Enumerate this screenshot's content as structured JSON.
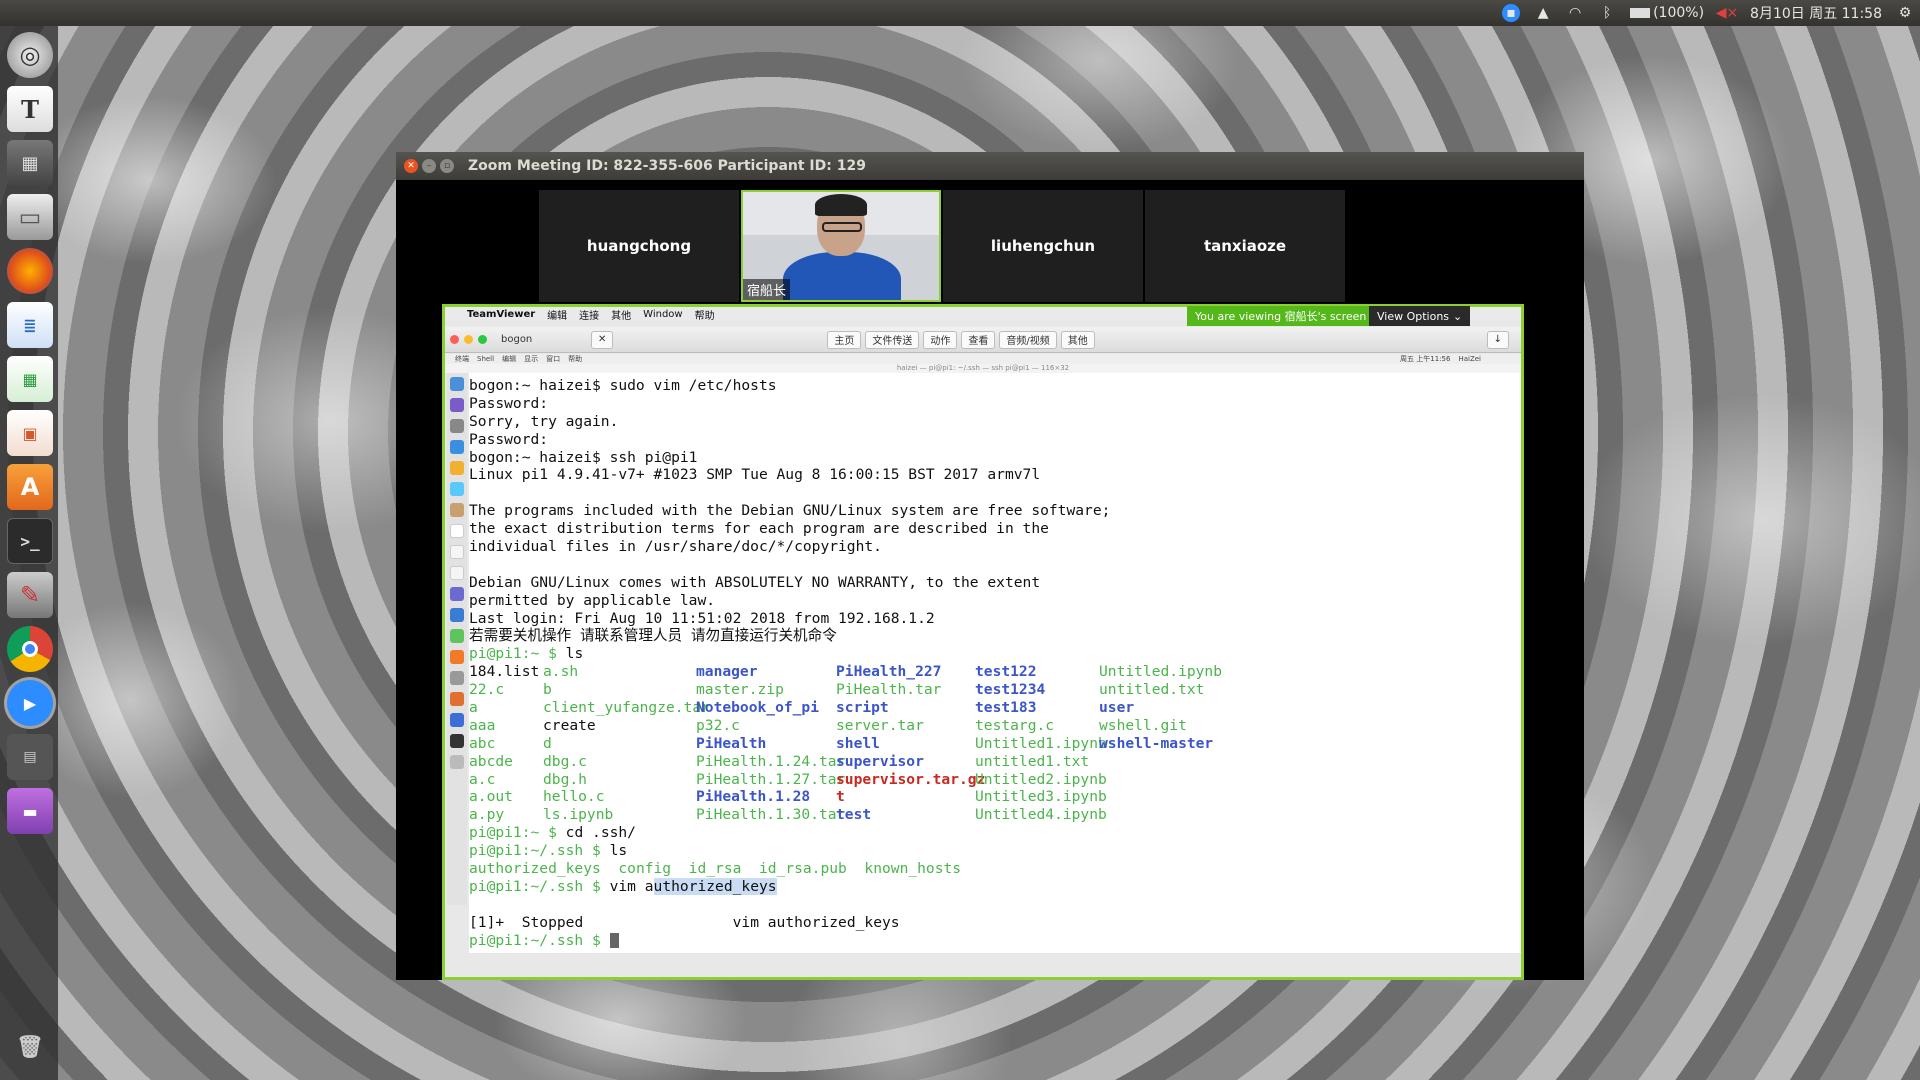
{
  "top_panel": {
    "battery": "(100%)",
    "datetime": "8月10日 周五 11:58"
  },
  "launcher": {
    "items": [
      "settings-icon",
      "text-editor-icon",
      "calculator-icon",
      "files-icon",
      "firefox-icon",
      "writer-icon",
      "calc-icon",
      "impress-icon",
      "software-center-icon",
      "terminal-icon",
      "system-settings-icon",
      "chrome-icon",
      "zoom-icon",
      "workspace-icon",
      "app-icon",
      "trash-icon"
    ]
  },
  "zoom": {
    "title": "Zoom Meeting ID: 822-355-606  Participant ID: 129",
    "participants": [
      "huangchong",
      "宿船长",
      "liuhengchun",
      "tanxiaoze"
    ],
    "viewing_banner": "You are viewing 宿船长's screen",
    "view_options": "View Options"
  },
  "shared_screen": {
    "mac_menu": [
      "TeamViewer",
      "编辑",
      "连接",
      "其他",
      "Window",
      "帮助"
    ],
    "tv_tab": "bogon",
    "toolbar": [
      "主页",
      "文件传送",
      "动作",
      "查看",
      "音频/视频",
      "其他"
    ],
    "inner_menu": [
      "终端",
      "Shell",
      "编辑",
      "显示",
      "窗口",
      "帮助"
    ],
    "inner_title": "haizei — pi@pi1: ~/.ssh — ssh pi@pi1 — 116×32",
    "inner_user": "HaiZei",
    "inner_clock": "周五 上午11:56"
  },
  "terminal": {
    "lines": [
      "bogon:~ haizei$ sudo vim /etc/hosts",
      "Password:",
      "Sorry, try again.",
      "Password:",
      "bogon:~ haizei$ ssh pi@pi1",
      "Linux pi1 4.9.41-v7+ #1023 SMP Tue Aug 8 16:00:15 BST 2017 armv7l",
      "",
      "The programs included with the Debian GNU/Linux system are free software;",
      "the exact distribution terms for each program are described in the",
      "individual files in /usr/share/doc/*/copyright.",
      "",
      "Debian GNU/Linux comes with ABSOLUTELY NO WARRANTY, to the extent",
      "permitted by applicable law.",
      "Last login: Fri Aug 10 11:51:02 2018 from 192.168.1.2",
      "若需要关机操作 请联系管理人员 请勿直接运行关机命令"
    ],
    "prompt_home": "pi@pi1:~ $",
    "prompt_ssh": "pi@pi1:~/.ssh $",
    "cmd_ls": "ls",
    "cmd_cd": "cd .ssh/",
    "cmd_vim": "vim ",
    "vim_arg_a": "a",
    "vim_arg_rest": "uthorized_keys",
    "ls_columns": [
      [
        {
          "t": "184.list",
          "c": ""
        },
        {
          "t": "22.c",
          "c": "g"
        },
        {
          "t": "a",
          "c": "g"
        },
        {
          "t": "aaa",
          "c": "g"
        },
        {
          "t": "abc",
          "c": "g"
        },
        {
          "t": "abcde",
          "c": "g"
        },
        {
          "t": "a.c",
          "c": "g"
        },
        {
          "t": "a.out",
          "c": "g"
        },
        {
          "t": "a.py",
          "c": "g"
        }
      ],
      [
        {
          "t": "a.sh",
          "c": "g"
        },
        {
          "t": "b",
          "c": "g"
        },
        {
          "t": "client_yufangze.tar",
          "c": "g"
        },
        {
          "t": "create",
          "c": ""
        },
        {
          "t": "d",
          "c": "g"
        },
        {
          "t": "dbg.c",
          "c": "g"
        },
        {
          "t": "dbg.h",
          "c": "g"
        },
        {
          "t": "hello.c",
          "c": "g"
        },
        {
          "t": "ls.ipynb",
          "c": "g"
        }
      ],
      [
        {
          "t": "manager",
          "c": "b"
        },
        {
          "t": "master.zip",
          "c": "g"
        },
        {
          "t": "Notebook_of_pi",
          "c": "b"
        },
        {
          "t": "p32.c",
          "c": "g"
        },
        {
          "t": "PiHealth",
          "c": "b"
        },
        {
          "t": "PiHealth.1.24.tar",
          "c": "g"
        },
        {
          "t": "PiHealth.1.27.tar",
          "c": "g"
        },
        {
          "t": "PiHealth.1.28",
          "c": "b"
        },
        {
          "t": "PiHealth.1.30.tar",
          "c": "g"
        }
      ],
      [
        {
          "t": "PiHealth_227",
          "c": "b"
        },
        {
          "t": "PiHealth.tar",
          "c": "g"
        },
        {
          "t": "script",
          "c": "b"
        },
        {
          "t": "server.tar",
          "c": "g"
        },
        {
          "t": "shell",
          "c": "b"
        },
        {
          "t": "supervisor",
          "c": "b"
        },
        {
          "t": "supervisor.tar.gz",
          "c": "r"
        },
        {
          "t": "t",
          "c": "r"
        },
        {
          "t": "test",
          "c": "b"
        }
      ],
      [
        {
          "t": "test122",
          "c": "b"
        },
        {
          "t": "test1234",
          "c": "b"
        },
        {
          "t": "test183",
          "c": "b"
        },
        {
          "t": "testarg.c",
          "c": "g"
        },
        {
          "t": "Untitled1.ipynb",
          "c": "g"
        },
        {
          "t": "untitled1.txt",
          "c": "g"
        },
        {
          "t": "Untitled2.ipynb",
          "c": "g"
        },
        {
          "t": "Untitled3.ipynb",
          "c": "g"
        },
        {
          "t": "Untitled4.ipynb",
          "c": "g"
        }
      ],
      [
        {
          "t": "Untitled.ipynb",
          "c": "g"
        },
        {
          "t": "untitled.txt",
          "c": "g"
        },
        {
          "t": "user",
          "c": "b"
        },
        {
          "t": "wshell.git",
          "c": "g"
        },
        {
          "t": "wshell-master",
          "c": "b"
        }
      ]
    ],
    "ssh_ls": [
      "authorized_keys",
      "config",
      "id_rsa",
      "id_rsa.pub",
      "known_hosts"
    ],
    "job_line": {
      "num": "[1]+",
      "state": "Stopped",
      "cmd": "vim authorized_keys"
    }
  }
}
